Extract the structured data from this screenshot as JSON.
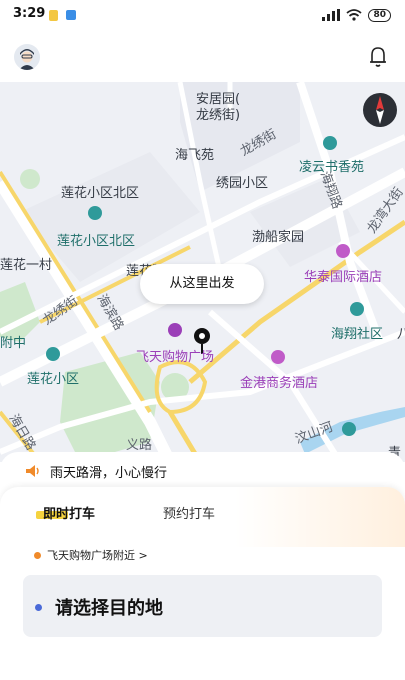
{
  "status_bar": {
    "time": "3:29",
    "battery": "80"
  },
  "map": {
    "pickup_tip": "从这里出发",
    "labels": {
      "anjuyuan": "安居园(",
      "longxiujie_bracket": "龙绣街)",
      "haifeiyuan": "海飞苑",
      "longxiujie": "龙绣街",
      "lingyun": "凌云书香苑",
      "xiuyuan": "绣园小区",
      "haixianglu": "海翔路",
      "longwan": "龙湾大街",
      "lianhua_north": "莲花小区北区",
      "lianhua_north_poi": "莲花小区北区",
      "bochuan": "渤船家园",
      "lianhua_yicun": "莲花一村",
      "lianhua_partial": "莲花馨",
      "huatai": "华泰国际酒店",
      "longxiujie2": "龙绣街",
      "haibinlu": "海滨路",
      "haixiang_community": "海翔社区",
      "ba": "八",
      "fuzhong": "附中",
      "feitian": "飞天购物广场",
      "lianhua_xiaoqu": "莲花小区",
      "jingang": "金港商务酒店",
      "hairilu": "海日路",
      "yilu": "义路",
      "shanhe": "汶山河",
      "qing": "青",
      "compass_north": "北"
    }
  },
  "notice": {
    "text": "雨天路滑，小心慢行"
  },
  "panel": {
    "tabs": [
      "即时打车",
      "预约打车"
    ],
    "origin": "飞天购物广场附近 >",
    "destination_placeholder": "请选择目的地"
  },
  "colors": {
    "accent_yellow": "#f5d33f",
    "origin_orange": "#f08a2a",
    "dest_blue": "#4a6ad8",
    "poi_purple": "#9b3fb8"
  }
}
